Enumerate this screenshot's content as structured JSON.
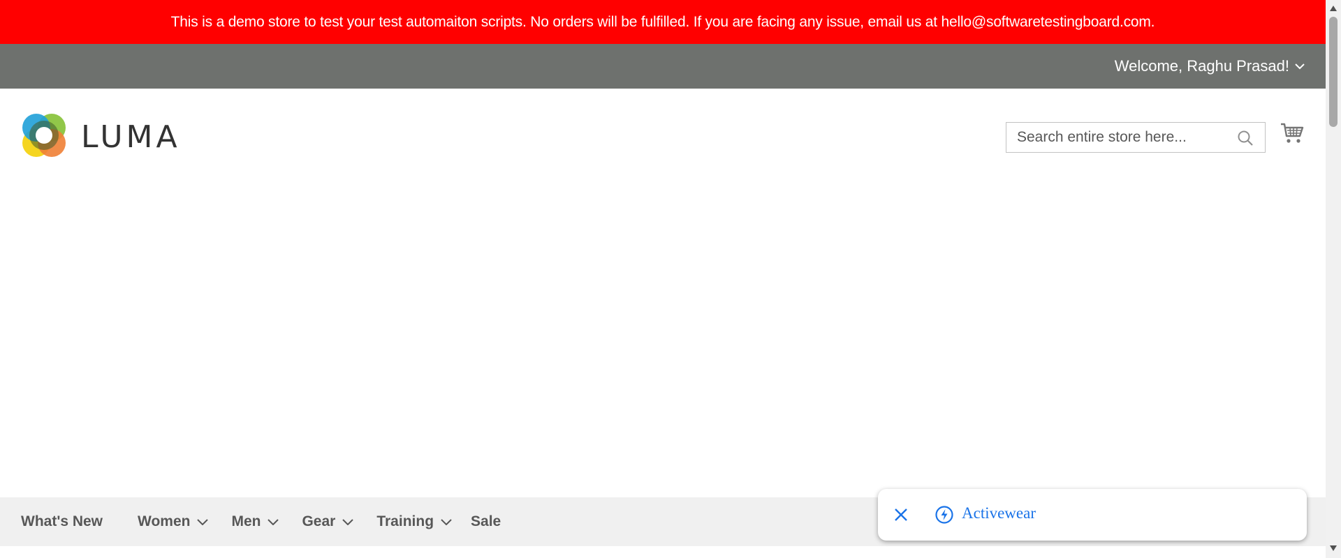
{
  "banner": {
    "text": "This is a demo store to test your test automaiton scripts. No orders will be fulfilled. If you are facing any issue, email us at hello@softwaretestingboard.com."
  },
  "header": {
    "welcome": "Welcome, Raghu Prasad!",
    "logo_text": "LUMA",
    "search": {
      "placeholder": "Search entire store here...",
      "value": ""
    }
  },
  "nav": {
    "items": [
      {
        "label": "What's New",
        "has_dropdown": false
      },
      {
        "label": "Women",
        "has_dropdown": true
      },
      {
        "label": "Men",
        "has_dropdown": true
      },
      {
        "label": "Gear",
        "has_dropdown": true
      },
      {
        "label": "Training",
        "has_dropdown": true
      },
      {
        "label": "Sale",
        "has_dropdown": false
      }
    ]
  },
  "autofill": {
    "suggestion": "Activewear"
  },
  "icons": {
    "welcome_toggle": "chevron-down-icon",
    "search": "search-icon",
    "cart": "cart-icon",
    "autofill_close": "close-icon",
    "autofill_bolt": "lightning-icon"
  },
  "colors": {
    "banner_bg": "#ff0000",
    "panel_bg": "#6e716e",
    "nav_bg": "#f0f0f0",
    "nav_text": "#575757",
    "autofill_accent": "#1a73e8"
  }
}
